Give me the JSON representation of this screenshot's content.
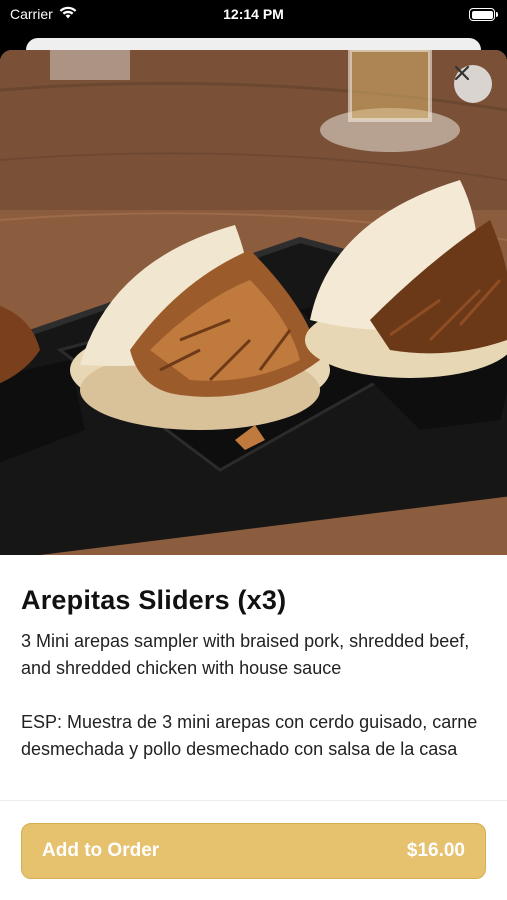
{
  "status_bar": {
    "carrier": "Carrier",
    "time": "12:14 PM"
  },
  "item": {
    "title": "Arepitas Sliders (x3)",
    "description": "3 Mini arepas sampler with braised pork, shredded beef, and shredded chicken with house sauce\n\nESP: Muestra de 3 mini arepas con cerdo guisado, carne desmechada y pollo desmechado con salsa de la casa"
  },
  "footer": {
    "add_label": "Add to Order",
    "price": "$16.00"
  },
  "icons": {
    "close": "close-icon",
    "wifi": "wifi-icon",
    "battery": "battery-icon"
  },
  "colors": {
    "button": "#e6c16e",
    "button_border": "#d7ad52"
  }
}
